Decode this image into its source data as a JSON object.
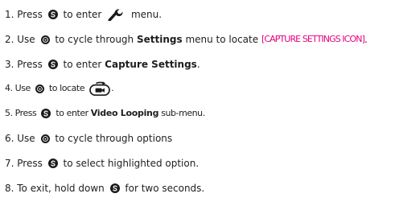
{
  "steps": [
    {
      "pre": "1. Press ",
      "mid": " to enter ",
      "post": " menu."
    },
    {
      "pre": "2. Use ",
      "mid": " to cycle through ",
      "bold": "Settings",
      "mid2": " menu to locate ",
      "highlight": "[CAPTURE SETTINGS ICON]",
      "post": "."
    },
    {
      "pre": "3. Press ",
      "mid": " to enter ",
      "bold": "Capture Settings",
      "post": "."
    },
    {
      "pre": "4. Use ",
      "mid": " to locate ",
      "post": "."
    },
    {
      "pre": "5. Press ",
      "mid": " to enter ",
      "bold": "Video Looping",
      "post": " sub-menu."
    },
    {
      "pre": "6. Use ",
      "post": " to cycle through options"
    },
    {
      "pre": "7. Press ",
      "post": " to select highlighted option."
    },
    {
      "pre": "8. To exit, hold down ",
      "post": " for two seconds."
    }
  ],
  "icons": {
    "shutter_select_button": "select-button-icon",
    "mode_button": "down-button-icon",
    "settings_wrench": "wrench-icon",
    "capture_settings": "capture-settings-icon"
  },
  "colors": {
    "text": "#1e1e1e",
    "icon": "#1a1a1a",
    "highlight": "#e6007e"
  }
}
